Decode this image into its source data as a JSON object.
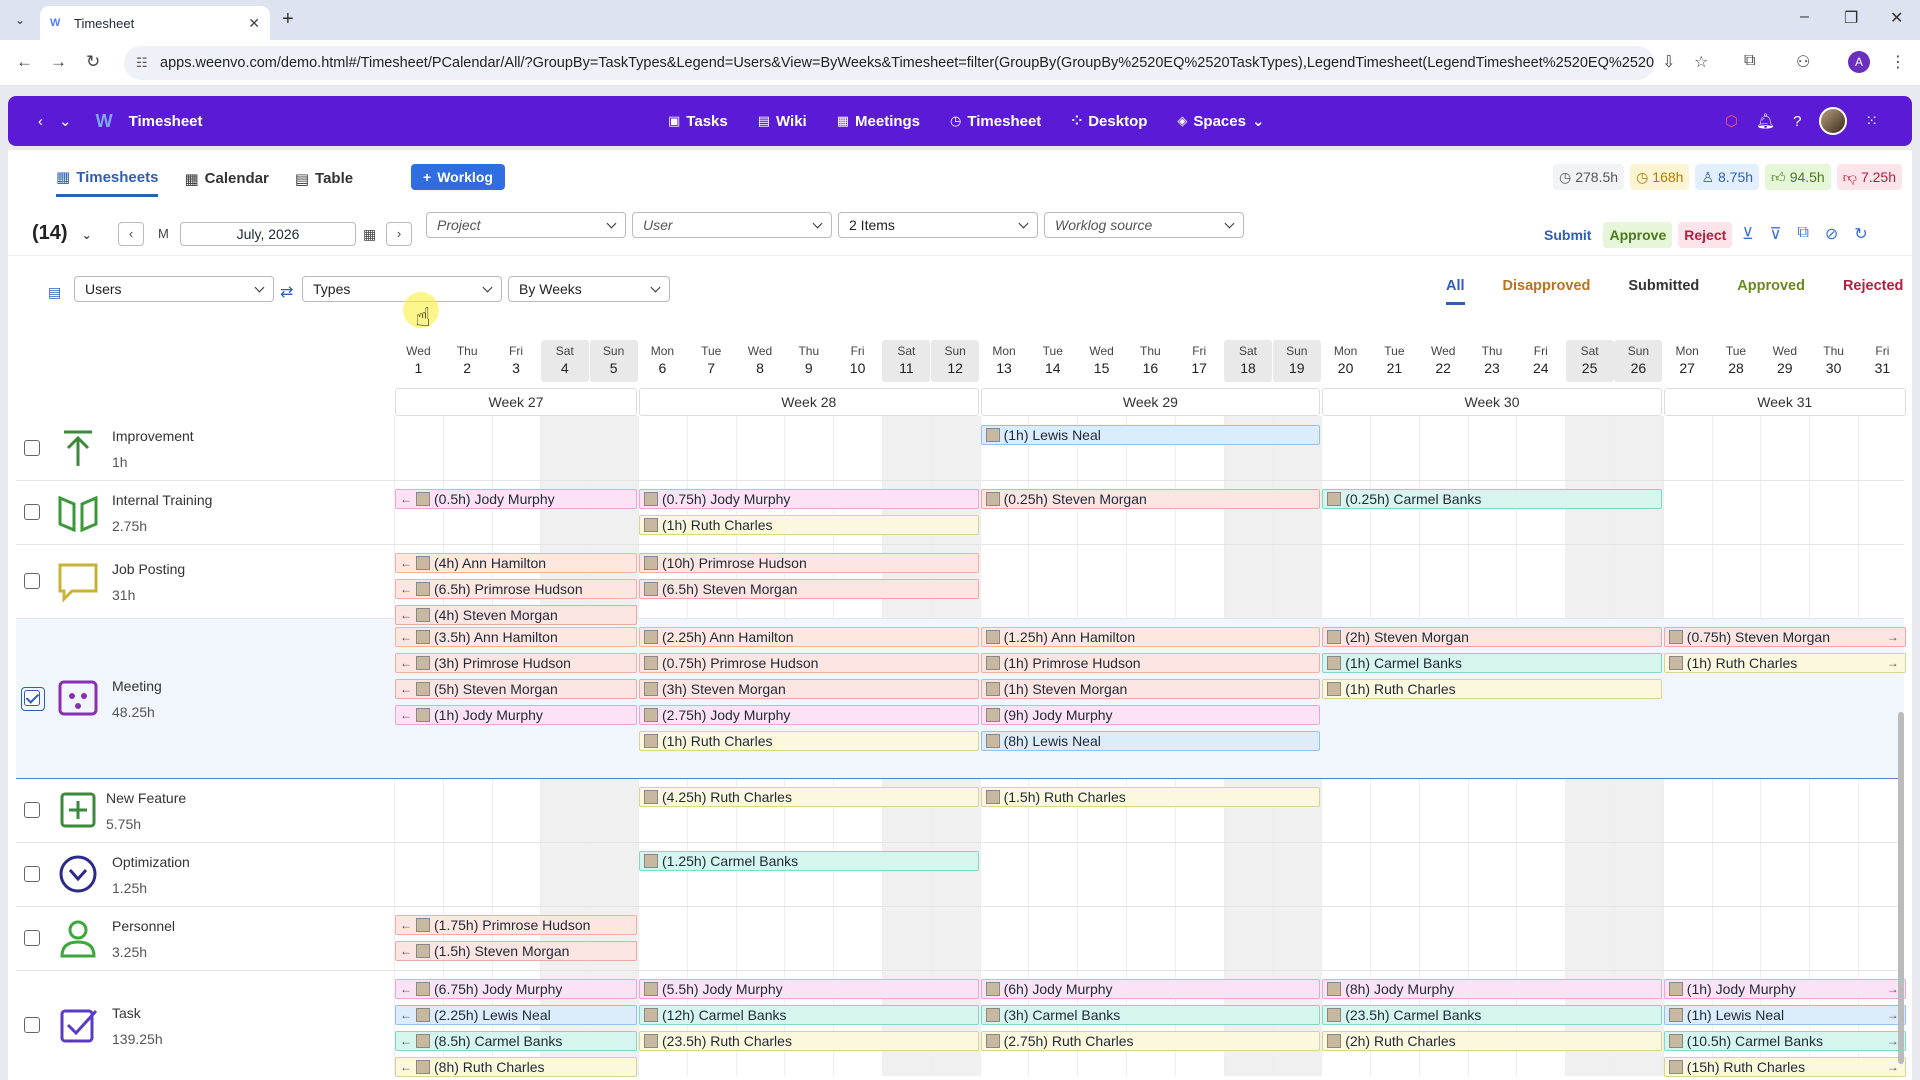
{
  "browser": {
    "tab_title": "Timesheet",
    "url": "apps.weenvo.com/demo.html#/Timesheet/PCalendar/All/?GroupBy=TaskTypes&Legend=Users&View=ByWeeks&Timesheet=filter(GroupBy(GroupBy%2520EQ%2520TaskTypes),LegendTimesheet(LegendTimesheet%2520EQ%2520Users),View...",
    "profile_initial": "A"
  },
  "app": {
    "title": "Timesheet",
    "nav": [
      "Tasks",
      "Wiki",
      "Meetings",
      "Timesheet",
      "Desktop",
      "Spaces"
    ]
  },
  "view_tabs": [
    "Timesheets",
    "Calendar",
    "Table"
  ],
  "worklog_button": "Worklog",
  "stats": [
    "278.5h",
    "168h",
    "8.75h",
    "94.5h",
    "7.25h"
  ],
  "colors": {
    "stat_bg": [
      "#f2f3f5",
      "#fdf4d3",
      "#e4effd",
      "#e6f6d8",
      "#fde4ea"
    ]
  },
  "filters": {
    "count": "(14)",
    "period_mode": "M",
    "date": "July, 2026",
    "project_placeholder": "Project",
    "user_placeholder": "User",
    "items_value": "2 Items",
    "source_placeholder": "Worklog source"
  },
  "actions": {
    "submit": "Submit",
    "approve": "Approve",
    "reject": "Reject"
  },
  "grouping": {
    "legend": "Users",
    "group_by": "Types",
    "view": "By Weeks"
  },
  "status_tabs": [
    "All",
    "Disapproved",
    "Submitted",
    "Approved",
    "Rejected"
  ],
  "days": [
    {
      "w": "Wed",
      "d": "1"
    },
    {
      "w": "Thu",
      "d": "2"
    },
    {
      "w": "Fri",
      "d": "3"
    },
    {
      "w": "Sat",
      "d": "4"
    },
    {
      "w": "Sun",
      "d": "5"
    },
    {
      "w": "Mon",
      "d": "6"
    },
    {
      "w": "Tue",
      "d": "7"
    },
    {
      "w": "Wed",
      "d": "8"
    },
    {
      "w": "Thu",
      "d": "9"
    },
    {
      "w": "Fri",
      "d": "10"
    },
    {
      "w": "Sat",
      "d": "11"
    },
    {
      "w": "Sun",
      "d": "12"
    },
    {
      "w": "Mon",
      "d": "13"
    },
    {
      "w": "Tue",
      "d": "14"
    },
    {
      "w": "Wed",
      "d": "15"
    },
    {
      "w": "Thu",
      "d": "16"
    },
    {
      "w": "Fri",
      "d": "17"
    },
    {
      "w": "Sat",
      "d": "18"
    },
    {
      "w": "Sun",
      "d": "19"
    },
    {
      "w": "Mon",
      "d": "20"
    },
    {
      "w": "Tue",
      "d": "21"
    },
    {
      "w": "Wed",
      "d": "22"
    },
    {
      "w": "Thu",
      "d": "23"
    },
    {
      "w": "Fri",
      "d": "24"
    },
    {
      "w": "Sat",
      "d": "25"
    },
    {
      "w": "Sun",
      "d": "26"
    },
    {
      "w": "Mon",
      "d": "27"
    },
    {
      "w": "Tue",
      "d": "28"
    },
    {
      "w": "Wed",
      "d": "29"
    },
    {
      "w": "Thu",
      "d": "30"
    },
    {
      "w": "Fri",
      "d": "31"
    }
  ],
  "weeks": [
    "Week 27",
    "Week 28",
    "Week 29",
    "Week 30",
    "Week 31"
  ],
  "task_types": [
    {
      "name": "Improvement",
      "hours": "1h",
      "checked": false
    },
    {
      "name": "Internal Training",
      "hours": "2.75h",
      "checked": false
    },
    {
      "name": "Job Posting",
      "hours": "31h",
      "checked": false
    },
    {
      "name": "Meeting",
      "hours": "48.25h",
      "checked": true
    },
    {
      "name": "New Feature",
      "hours": "5.75h",
      "checked": false
    },
    {
      "name": "Optimization",
      "hours": "1.25h",
      "checked": false
    },
    {
      "name": "Personnel",
      "hours": "3.25h",
      "checked": false
    },
    {
      "name": "Task",
      "hours": "139.25h",
      "checked": false
    }
  ],
  "entries": [
    {
      "row": 0,
      "week": 2,
      "lane": 0,
      "label": "(1h) Lewis Neal",
      "user": "lewis"
    },
    {
      "row": 1,
      "week": 0,
      "lane": 0,
      "label": "(0.5h) Jody Murphy",
      "user": "jody"
    },
    {
      "row": 1,
      "week": 1,
      "lane": 0,
      "label": "(0.75h) Jody Murphy",
      "user": "jody"
    },
    {
      "row": 1,
      "week": 1,
      "lane": 1,
      "label": "(1h) Ruth Charles",
      "user": "ruth"
    },
    {
      "row": 1,
      "week": 2,
      "lane": 0,
      "label": "(0.25h) Steven Morgan",
      "user": "steven"
    },
    {
      "row": 1,
      "week": 3,
      "lane": 0,
      "label": "(0.25h) Carmel Banks",
      "user": "carmel"
    },
    {
      "row": 2,
      "week": 0,
      "lane": 0,
      "label": "(4h) Ann Hamilton",
      "user": "ann"
    },
    {
      "row": 2,
      "week": 0,
      "lane": 1,
      "label": "(6.5h) Primrose Hudson",
      "user": "prim"
    },
    {
      "row": 2,
      "week": 0,
      "lane": 2,
      "label": "(4h) Steven Morgan",
      "user": "steven"
    },
    {
      "row": 2,
      "week": 1,
      "lane": 0,
      "label": "(10h) Primrose Hudson",
      "user": "prim"
    },
    {
      "row": 2,
      "week": 1,
      "lane": 1,
      "label": "(6.5h) Steven Morgan",
      "user": "steven"
    },
    {
      "row": 3,
      "week": 0,
      "lane": 0,
      "label": "(3.5h) Ann Hamilton",
      "user": "ann"
    },
    {
      "row": 3,
      "week": 0,
      "lane": 1,
      "label": "(3h) Primrose Hudson",
      "user": "prim"
    },
    {
      "row": 3,
      "week": 0,
      "lane": 2,
      "label": "(5h) Steven Morgan",
      "user": "steven"
    },
    {
      "row": 3,
      "week": 0,
      "lane": 3,
      "label": "(1h) Jody Murphy",
      "user": "jody"
    },
    {
      "row": 3,
      "week": 1,
      "lane": 0,
      "label": "(2.25h) Ann Hamilton",
      "user": "ann"
    },
    {
      "row": 3,
      "week": 1,
      "lane": 1,
      "label": "(0.75h) Primrose Hudson",
      "user": "prim"
    },
    {
      "row": 3,
      "week": 1,
      "lane": 2,
      "label": "(3h) Steven Morgan",
      "user": "steven"
    },
    {
      "row": 3,
      "week": 1,
      "lane": 3,
      "label": "(2.75h) Jody Murphy",
      "user": "jody"
    },
    {
      "row": 3,
      "week": 1,
      "lane": 4,
      "label": "(1h) Ruth Charles",
      "user": "ruth"
    },
    {
      "row": 3,
      "week": 2,
      "lane": 0,
      "label": "(1.25h) Ann Hamilton",
      "user": "ann"
    },
    {
      "row": 3,
      "week": 2,
      "lane": 1,
      "label": "(1h) Primrose Hudson",
      "user": "prim"
    },
    {
      "row": 3,
      "week": 2,
      "lane": 2,
      "label": "(1h) Steven Morgan",
      "user": "steven"
    },
    {
      "row": 3,
      "week": 2,
      "lane": 3,
      "label": "(9h) Jody Murphy",
      "user": "jody"
    },
    {
      "row": 3,
      "week": 2,
      "lane": 4,
      "label": "(8h) Lewis Neal",
      "user": "lewis"
    },
    {
      "row": 3,
      "week": 3,
      "lane": 0,
      "label": "(2h) Steven Morgan",
      "user": "steven"
    },
    {
      "row": 3,
      "week": 3,
      "lane": 1,
      "label": "(1h) Carmel Banks",
      "user": "carmel"
    },
    {
      "row": 3,
      "week": 3,
      "lane": 2,
      "label": "(1h) Ruth Charles",
      "user": "ruth"
    },
    {
      "row": 3,
      "week": 4,
      "lane": 0,
      "label": "(0.75h) Steven Morgan",
      "user": "steven"
    },
    {
      "row": 3,
      "week": 4,
      "lane": 1,
      "label": "(1h) Ruth Charles",
      "user": "ruth"
    },
    {
      "row": 4,
      "week": 1,
      "lane": 0,
      "label": "(4.25h) Ruth Charles",
      "user": "ruth"
    },
    {
      "row": 4,
      "week": 2,
      "lane": 0,
      "label": "(1.5h) Ruth Charles",
      "user": "ruth"
    },
    {
      "row": 5,
      "week": 1,
      "lane": 0,
      "label": "(1.25h) Carmel Banks",
      "user": "carmel"
    },
    {
      "row": 6,
      "week": 0,
      "lane": 0,
      "label": "(1.75h) Primrose Hudson",
      "user": "prim"
    },
    {
      "row": 6,
      "week": 0,
      "lane": 1,
      "label": "(1.5h) Steven Morgan",
      "user": "steven"
    },
    {
      "row": 7,
      "week": 0,
      "lane": 0,
      "label": "(6.75h) Jody Murphy",
      "user": "jody"
    },
    {
      "row": 7,
      "week": 0,
      "lane": 1,
      "label": "(2.25h) Lewis Neal",
      "user": "lewis"
    },
    {
      "row": 7,
      "week": 0,
      "lane": 2,
      "label": "(8.5h) Carmel Banks",
      "user": "carmel"
    },
    {
      "row": 7,
      "week": 0,
      "lane": 3,
      "label": "(8h) Ruth Charles",
      "user": "ruth"
    },
    {
      "row": 7,
      "week": 1,
      "lane": 0,
      "label": "(5.5h) Jody Murphy",
      "user": "jody"
    },
    {
      "row": 7,
      "week": 1,
      "lane": 1,
      "label": "(12h) Carmel Banks",
      "user": "carmel"
    },
    {
      "row": 7,
      "week": 1,
      "lane": 2,
      "label": "(23.5h) Ruth Charles",
      "user": "ruth"
    },
    {
      "row": 7,
      "week": 2,
      "lane": 0,
      "label": "(6h) Jody Murphy",
      "user": "jody"
    },
    {
      "row": 7,
      "week": 2,
      "lane": 1,
      "label": "(3h) Carmel Banks",
      "user": "carmel"
    },
    {
      "row": 7,
      "week": 2,
      "lane": 2,
      "label": "(2.75h) Ruth Charles",
      "user": "ruth"
    },
    {
      "row": 7,
      "week": 3,
      "lane": 0,
      "label": "(8h) Jody Murphy",
      "user": "jody"
    },
    {
      "row": 7,
      "week": 3,
      "lane": 1,
      "label": "(23.5h) Carmel Banks",
      "user": "carmel"
    },
    {
      "row": 7,
      "week": 3,
      "lane": 2,
      "label": "(2h) Ruth Charles",
      "user": "ruth"
    },
    {
      "row": 7,
      "week": 4,
      "lane": 0,
      "label": "(1h) Jody Murphy",
      "user": "jody"
    },
    {
      "row": 7,
      "week": 4,
      "lane": 1,
      "label": "(1h) Lewis Neal",
      "user": "lewis"
    },
    {
      "row": 7,
      "week": 4,
      "lane": 2,
      "label": "(10.5h) Carmel Banks",
      "user": "carmel"
    },
    {
      "row": 7,
      "week": 4,
      "lane": 3,
      "label": "(15h) Ruth Charles",
      "user": "ruth"
    }
  ]
}
